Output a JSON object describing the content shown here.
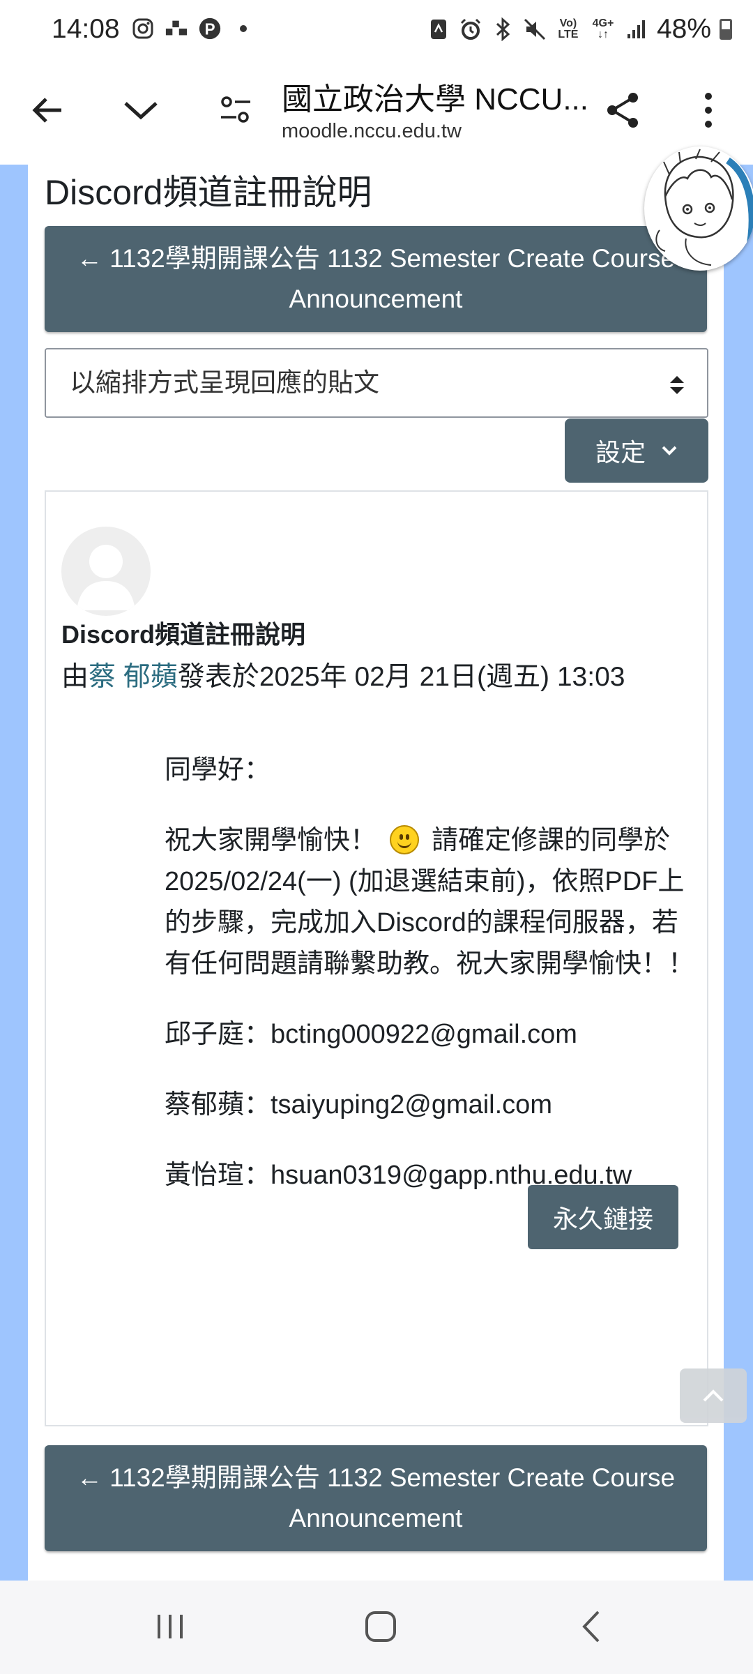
{
  "status_bar": {
    "time": "14:08",
    "battery": "48%",
    "network_top": "Vo)",
    "network_bottom": "LTE",
    "signal_type": "4G+"
  },
  "browser": {
    "title": "國立政治大學 NCCU...",
    "url": "moodle.nccu.edu.tw"
  },
  "page": {
    "heading": "Discord頻道註冊說明",
    "prev_link_top": "← 1132學期開課公告 1132 Semester Create Course Announcement",
    "display_mode": "以縮排方式呈現回應的貼文",
    "settings_label": "設定",
    "post": {
      "title": "Discord頻道註冊說明",
      "by_prefix": "由",
      "author": "蔡 郁蘋",
      "posted_text": "發表於2025年 02月 21日(週五) 13:03",
      "greeting": "同學好：",
      "body_part1": "祝大家開學愉快！",
      "body_part2": "請確定修課的同學於2025/02/24(一) (加退選結束前)，依照PDF上的步驟，完成加入Discord的課程伺服器，若有任何問題請聯繫助教。祝大家開學愉快！！",
      "contact1": "邱子庭：bcting000922@gmail.com",
      "contact2": "蔡郁蘋：tsaiyuping2@gmail.com",
      "contact3": "黃怡瑄：hsuan0319@gapp.nthu.edu.tw",
      "permalink_label": "永久鏈接"
    },
    "prev_link_bottom": "← 1132學期開課公告 1132 Semester Create Course Announcement"
  },
  "colors": {
    "button_bg": "#4e6470",
    "page_side": "#9ec5fe",
    "author_link": "#2b6c80"
  },
  "icons": {
    "back": "arrow-left-icon",
    "dropdown": "chevron-down-icon",
    "page_settings": "tune-icon",
    "share": "share-icon",
    "menu": "more-vert-icon",
    "scroll_top": "chevron-up-icon"
  }
}
